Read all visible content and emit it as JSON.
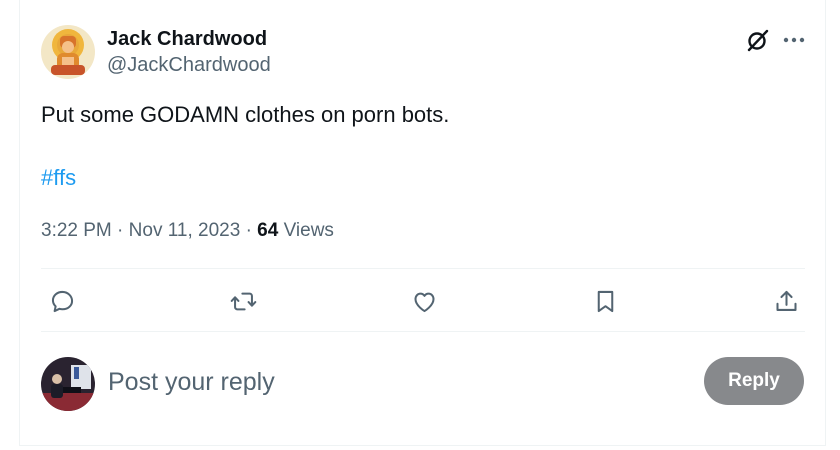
{
  "author": {
    "name": "Jack Chardwood",
    "handle": "@JackChardwood"
  },
  "post": {
    "text": "Put some GODAMN clothes on porn bots.",
    "hashtag": "#ffs",
    "time": "3:22 PM",
    "separator": "·",
    "date": "Nov 11, 2023",
    "views_count": "64",
    "views_label": "Views"
  },
  "icons": {
    "header": [
      "grok-icon",
      "more-icon"
    ],
    "actions": [
      "reply-icon",
      "repost-icon",
      "like-icon",
      "bookmark-icon",
      "share-icon"
    ]
  },
  "reply": {
    "placeholder": "Post your reply",
    "button_label": "Reply"
  },
  "colors": {
    "link": "#1d9bf0",
    "secondary_text": "#536471",
    "reply_button_bg": "#87898c",
    "divider": "#eff3f4"
  }
}
